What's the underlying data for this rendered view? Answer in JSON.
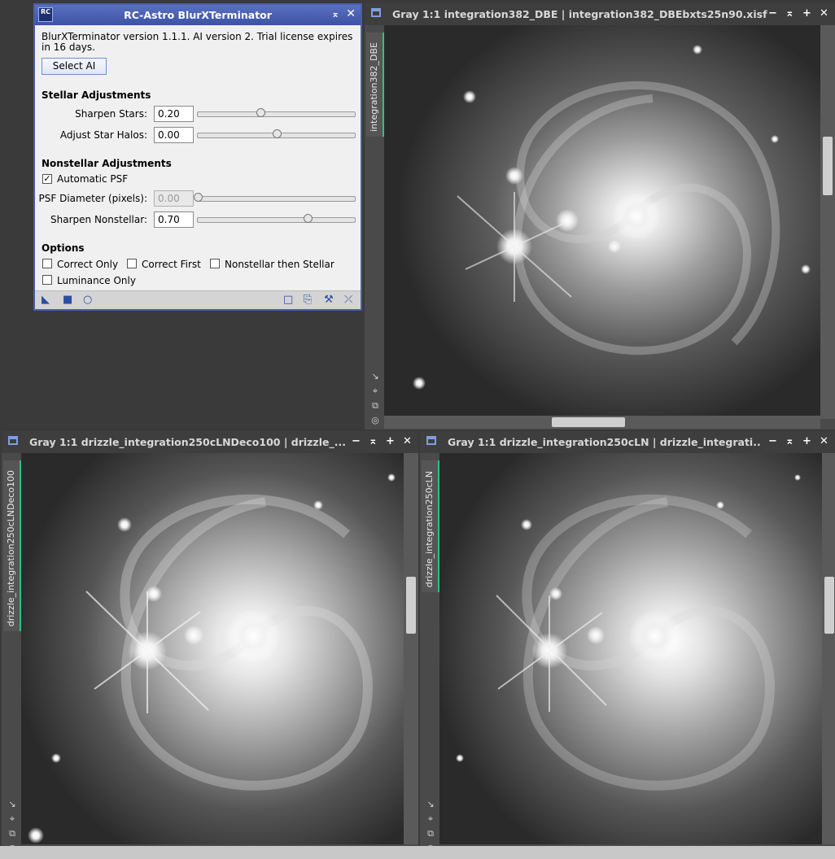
{
  "dialog": {
    "title": "RC-Astro BlurXTerminator",
    "logo": "RC",
    "minimize_icon": "shade-icon",
    "close_icon": "close-icon",
    "version_text": "BlurXTerminator version 1.1.1. AI version 2. Trial license expires in 16 days.",
    "select_ai_label": "Select AI",
    "stellar": {
      "header": "Stellar Adjustments",
      "sharpen_stars_label": "Sharpen Stars:",
      "sharpen_stars_value": "0.20",
      "sharpen_stars_fraction": 0.4,
      "adjust_halos_label": "Adjust Star Halos:",
      "adjust_halos_value": "0.00",
      "adjust_halos_fraction": 0.5
    },
    "nonstellar": {
      "header": "Nonstellar Adjustments",
      "automatic_psf_label": "Automatic PSF",
      "automatic_psf_checked": true,
      "psf_diameter_label": "PSF Diameter (pixels):",
      "psf_diameter_value": "0.00",
      "psf_diameter_fraction": 0.0,
      "sharpen_nonstellar_label": "Sharpen Nonstellar:",
      "sharpen_nonstellar_value": "0.70",
      "sharpen_nonstellar_fraction": 0.7
    },
    "options": {
      "header": "Options",
      "correct_only": "Correct Only",
      "correct_first": "Correct First",
      "nonstellar_then_stellar": "Nonstellar then Stellar",
      "luminance_only": "Luminance Only"
    },
    "footer_icons": [
      "new-instance-icon",
      "apply-global-icon",
      "execute-icon",
      "preview-icon",
      "save-icon",
      "settings-icon",
      "reset-icon"
    ]
  },
  "windows": [
    {
      "title": "Gray 1:1 integration382_DBE | integration382_DBEbxts25n90.xisf",
      "tab": "integration382_DBE"
    },
    {
      "title": "Gray 1:1 drizzle_integration250cLNDeco100 | drizzle_...",
      "tab": "drizzle_integration250cLNDeco100"
    },
    {
      "title": "Gray 1:1 drizzle_integration250cLN | drizzle_integrati...",
      "tab": "drizzle_integration250cLN"
    }
  ],
  "window_controls": [
    "−",
    "⌅",
    "+",
    "✕"
  ],
  "side_icons": [
    "↘",
    "⌖",
    "⧉",
    "◎"
  ]
}
